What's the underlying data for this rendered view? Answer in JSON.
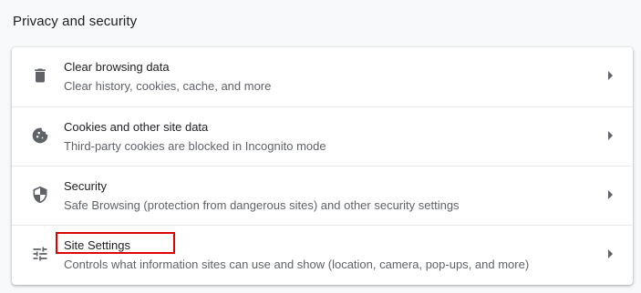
{
  "section": {
    "title": "Privacy and security"
  },
  "items": [
    {
      "label": "Clear browsing data",
      "sublabel": "Clear history, cookies, cache, and more",
      "icon": "trash-icon"
    },
    {
      "label": "Cookies and other site data",
      "sublabel": "Third-party cookies are blocked in Incognito mode",
      "icon": "cookie-icon"
    },
    {
      "label": "Security",
      "sublabel": "Safe Browsing (protection from dangerous sites) and other security settings",
      "icon": "shield-icon"
    },
    {
      "label": "Site Settings",
      "sublabel": "Controls what information sites can use and show (location, camera, pop-ups, and more)",
      "icon": "tune-sliders-icon"
    }
  ],
  "annotation": {
    "highlight_color": "#e00000",
    "highlighted_item": "Site Settings"
  },
  "colors": {
    "background": "#f8f9fa",
    "card": "#ffffff",
    "primary_text": "#202124",
    "secondary_text": "#5f6368",
    "divider": "#e8eaed"
  }
}
